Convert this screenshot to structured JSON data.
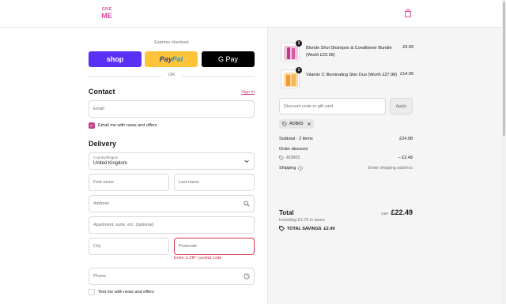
{
  "header": {
    "logo_line1": "GIVE",
    "logo_line2": "ME",
    "cart_icon": "shopping-bag-icon"
  },
  "express": {
    "title": "Express checkout",
    "shop_label": "shop",
    "paypal_label_a": "Pay",
    "paypal_label_b": "Pal",
    "gpay_label": "G Pay",
    "or_label": "OR"
  },
  "contact": {
    "title": "Contact",
    "signin_label": "Sign in",
    "email_placeholder": "Email",
    "newsletter_label": "Email me with news and offers",
    "newsletter_checked": true
  },
  "delivery": {
    "title": "Delivery",
    "country_label": "Country/Region",
    "country_value": "United Kingdom",
    "first_name_placeholder": "First name",
    "last_name_placeholder": "Last name",
    "address_placeholder": "Address",
    "apartment_placeholder": "Apartment, suite, etc. (optional)",
    "city_placeholder": "City",
    "postcode_placeholder": "Postcode",
    "postcode_error": "Enter a ZIP / postal code",
    "phone_placeholder": "Phone",
    "text_offers_label": "Text me with news and offers"
  },
  "order": {
    "items": [
      {
        "name": "Blonde Shot Shampoo & Conditioner Bundle (Worth £23.98)",
        "price": "£9.99",
        "qty": "1"
      },
      {
        "name": "Vitamin C Illuminating Skin Duo (Worth £27.98)",
        "price": "£14.99",
        "qty": "1"
      }
    ],
    "discount_placeholder": "Discount code or gift card",
    "apply_label": "Apply",
    "applied_code": "ADB65",
    "subtotal_label": "Subtotal · 2 items",
    "subtotal_value": "£24.98",
    "order_discount_label": "Order discount",
    "order_discount_code": "ADB65",
    "order_discount_value": "− £2.49",
    "shipping_label": "Shipping",
    "shipping_value": "Enter shipping address",
    "total_label": "Total",
    "total_currency": "GBP",
    "total_value": "£22.49",
    "taxes_note": "Including £3.75 in taxes",
    "savings_label": "TOTAL SAVINGS",
    "savings_value": "£2.49"
  },
  "colors": {
    "brand_pink": "#e0479e",
    "link_pink": "#c6428f",
    "shop_purple": "#5a31f4",
    "paypal_yellow": "#ffc439",
    "error_red": "#d3334f"
  }
}
